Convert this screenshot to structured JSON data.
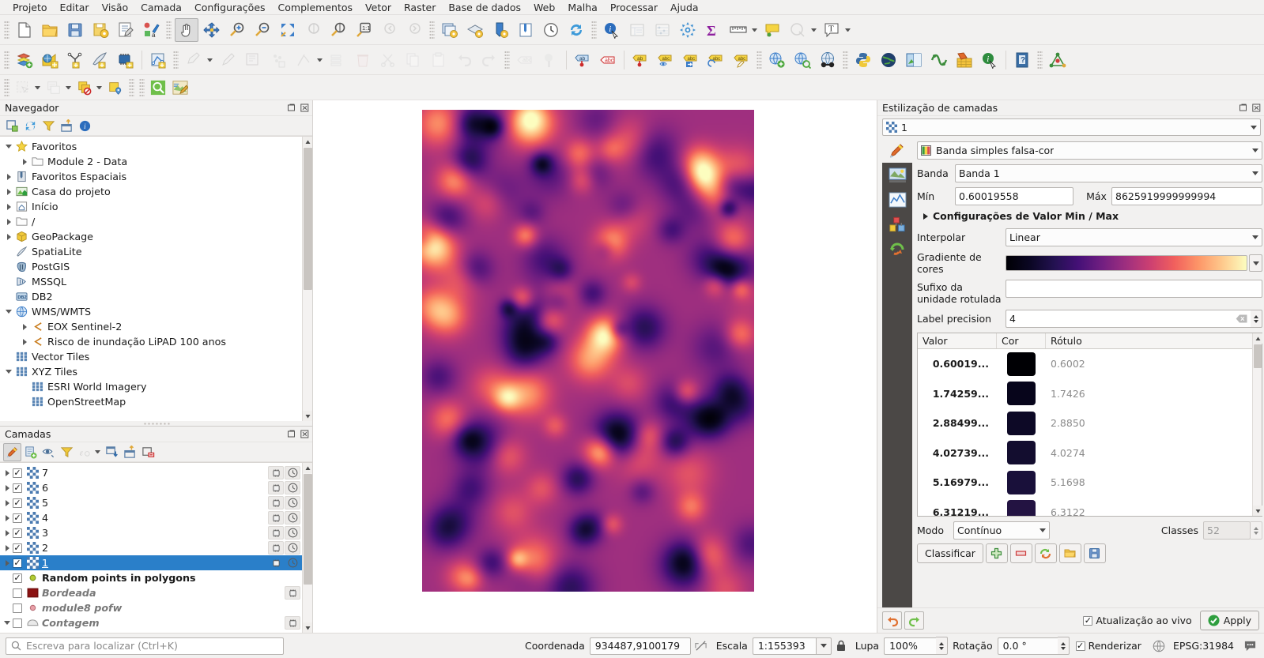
{
  "app": {
    "title": "QGIS"
  },
  "menu": [
    {
      "label": "Projeto"
    },
    {
      "label": "Editar"
    },
    {
      "label": "Visão"
    },
    {
      "label": "Camada"
    },
    {
      "label": "Configurações"
    },
    {
      "label": "Complementos"
    },
    {
      "label": "Vetor"
    },
    {
      "label": "Raster"
    },
    {
      "label": "Base de dados"
    },
    {
      "label": "Web"
    },
    {
      "label": "Malha"
    },
    {
      "label": "Processar"
    },
    {
      "label": "Ajuda"
    }
  ],
  "browser": {
    "title": "Navegador",
    "toolbar": [
      "add-layer-icon",
      "refresh-icon",
      "filter-icon",
      "collapse-all-icon",
      "properties-icon"
    ],
    "items": [
      {
        "label": "Favoritos",
        "icon": "star-icon",
        "indent": 0,
        "expanded": true
      },
      {
        "label": "Module 2 - Data",
        "icon": "folder-icon",
        "indent": 1,
        "collapsed": true
      },
      {
        "label": "Favoritos Espaciais",
        "icon": "bookmark-icon",
        "indent": 0,
        "collapsed": true
      },
      {
        "label": "Casa do projeto",
        "icon": "project-home-icon",
        "indent": 0,
        "collapsed": true
      },
      {
        "label": "Início",
        "icon": "home-icon",
        "indent": 0,
        "collapsed": true
      },
      {
        "label": "/",
        "icon": "folder-icon",
        "indent": 0,
        "collapsed": true
      },
      {
        "label": "GeoPackage",
        "icon": "geopackage-icon",
        "indent": 0,
        "collapsed": true
      },
      {
        "label": "SpatiaLite",
        "icon": "spatialite-icon",
        "indent": 0
      },
      {
        "label": "PostGIS",
        "icon": "postgis-icon",
        "indent": 0
      },
      {
        "label": "MSSQL",
        "icon": "mssql-icon",
        "indent": 0
      },
      {
        "label": "DB2",
        "icon": "db2-icon",
        "indent": 0
      },
      {
        "label": "WMS/WMTS",
        "icon": "wms-icon",
        "indent": 0,
        "expanded": true
      },
      {
        "label": "EOX Sentinel-2",
        "icon": "wms-connection-icon",
        "indent": 1,
        "collapsed": true
      },
      {
        "label": "Risco de inundação LiPAD 100 anos",
        "icon": "wms-connection-icon",
        "indent": 1,
        "collapsed": true
      },
      {
        "label": "Vector Tiles",
        "icon": "tiles-icon",
        "indent": 0
      },
      {
        "label": "XYZ Tiles",
        "icon": "tiles-icon",
        "indent": 0,
        "expanded": true
      },
      {
        "label": "ESRI World Imagery",
        "icon": "tiles-icon",
        "indent": 1
      },
      {
        "label": "OpenStreetMap",
        "icon": "tiles-icon",
        "indent": 1
      }
    ]
  },
  "layers": {
    "title": "Camadas",
    "toolbar": [
      "open-style-manager-icon",
      "add-group-icon",
      "manage-visibility-icon",
      "filter-legend-icon",
      "expression-filter-icon",
      "expand-all-icon",
      "collapse-all-icon",
      "remove-layer-icon"
    ],
    "items": [
      {
        "name": "7",
        "type": "raster",
        "checked": true,
        "expandable": true,
        "selected": false
      },
      {
        "name": "6",
        "type": "raster",
        "checked": true,
        "expandable": true,
        "selected": false
      },
      {
        "name": "5",
        "type": "raster",
        "checked": true,
        "expandable": true,
        "selected": false
      },
      {
        "name": "4",
        "type": "raster",
        "checked": true,
        "expandable": true,
        "selected": false
      },
      {
        "name": "3",
        "type": "raster",
        "checked": true,
        "expandable": true,
        "selected": false
      },
      {
        "name": "2",
        "type": "raster",
        "checked": true,
        "expandable": true,
        "selected": false
      },
      {
        "name": "1",
        "type": "raster",
        "checked": true,
        "expandable": true,
        "selected": true
      },
      {
        "name": "Random points in polygons",
        "type": "point",
        "checked": true,
        "expandable": false,
        "selected": false,
        "bold": true
      },
      {
        "name": "Bordeada",
        "type": "polygon",
        "checked": false,
        "expandable": false,
        "selected": false,
        "italic": true
      },
      {
        "name": "module8 pofw",
        "type": "point-pink",
        "checked": false,
        "expandable": false,
        "selected": false,
        "italic": true
      },
      {
        "name": "Contagem",
        "type": "polygon-grey",
        "checked": false,
        "expandable": true,
        "selected": false,
        "italic": true
      }
    ]
  },
  "style_panel": {
    "title": "Estilização de camadas",
    "layer_selected": "1",
    "renderer": "Banda simples falsa-cor",
    "band_label": "Banda",
    "band_value": "Banda 1",
    "min_label": "Mín",
    "min_value": "0.60019558",
    "max_label": "Máx",
    "max_value": "8625919999999994",
    "minmax_section": "Configurações de Valor Min / Max",
    "interpolate_label": "Interpolar",
    "interpolate_value": "Linear",
    "ramp_label": "Gradiente de cores",
    "suffix_label": "Sufixo da unidade rotulada",
    "suffix_value": "",
    "precision_label": "Label precision",
    "precision_value": "4",
    "table_headers": {
      "value": "Valor",
      "color": "Cor",
      "label": "Rótulo"
    },
    "table_rows": [
      {
        "value": "0.60019...",
        "color": "#000004",
        "label": "0.6002"
      },
      {
        "value": "1.74259...",
        "color": "#07051b",
        "label": "1.7426"
      },
      {
        "value": "2.88499...",
        "color": "#0d0926",
        "label": "2.8850"
      },
      {
        "value": "4.02739...",
        "color": "#130d2f",
        "label": "4.0274"
      },
      {
        "value": "5.16979...",
        "color": "#19103a",
        "label": "5.1698"
      },
      {
        "value": "6.31219...",
        "color": "#231342",
        "label": "6.3122"
      }
    ],
    "mode_label": "Modo",
    "mode_value": "Contínuo",
    "classes_label": "Classes",
    "classes_value": "52",
    "classify_label": "Classificar",
    "classify_buttons": [
      "add-class-icon",
      "remove-class-icon",
      "sort-icon",
      "load-icon",
      "save-icon"
    ],
    "undo_label": "undo-icon",
    "redo_label": "redo-icon",
    "live_update_label": "Atualização ao vivo",
    "live_update_checked": true,
    "apply_label": "Apply"
  },
  "statusbar": {
    "locator_placeholder": "Escreva para localizar (Ctrl+K)",
    "coord_label": "Coordenada",
    "coord_value": "934487,9100179",
    "scale_label": "Escala",
    "scale_value": "1:155393",
    "magnifier_label": "Lupa",
    "magnifier_value": "100%",
    "rotation_label": "Rotação",
    "rotation_value": "0.0 °",
    "render_label": "Renderizar",
    "render_checked": true,
    "crs_label": "EPSG:31984"
  },
  "map": {
    "colormap": "magma",
    "background": "#ffffff"
  },
  "colors": {
    "selection": "#2a7fc9",
    "panel_bg": "#f2f1f0",
    "accent_green": "#2e9e3e"
  }
}
